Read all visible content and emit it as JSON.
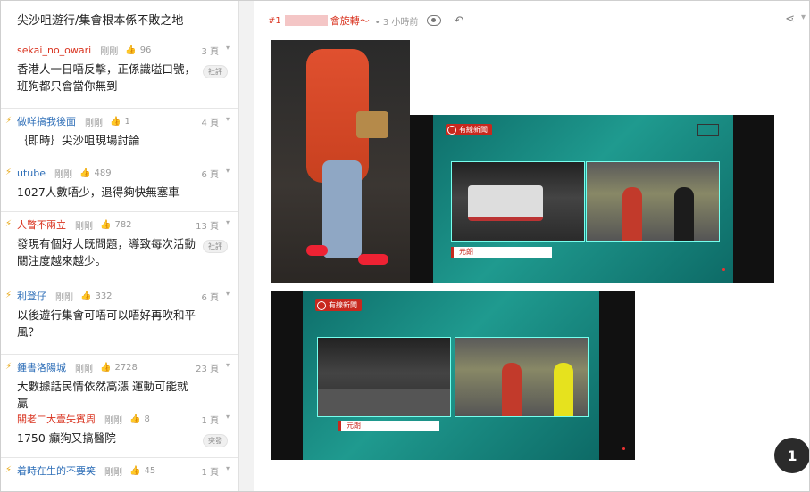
{
  "list": {
    "header": "尖沙咀遊行/集會根本係不敗之地",
    "items": [
      {
        "author": "sekai_no_owari",
        "author_color": "red",
        "bolt": false,
        "time": "剛剛",
        "likes": "96",
        "pages": "3 頁",
        "title": "香港人一日唔反擊，正係識嗌口號，班狗都只會當你無到",
        "tag": "社評",
        "size": "tall"
      },
      {
        "author": "做咩搞我後面",
        "author_color": "blue",
        "bolt": true,
        "time": "剛剛",
        "likes": "1",
        "pages": "4 頁",
        "title": "｛即時｝尖沙咀現場討論",
        "tag": "",
        "size": ""
      },
      {
        "author": "utube",
        "author_color": "blue",
        "bolt": true,
        "time": "剛剛",
        "likes": "489",
        "pages": "6 頁",
        "title": "1027人數唔少，退得夠快無塞車",
        "tag": "",
        "size": ""
      },
      {
        "author": "人瞥不兩立",
        "author_color": "red",
        "bolt": true,
        "time": "剛剛",
        "likes": "782",
        "pages": "13 頁",
        "title": "發現有個好大既問題，導致每次活動關注度越來越少。",
        "tag": "社評",
        "size": "tall"
      },
      {
        "author": "利登仔",
        "author_color": "blue",
        "bolt": true,
        "time": "剛剛",
        "likes": "332",
        "pages": "6 頁",
        "title": "以後遊行集會可唔可以唔好再吹和平風？",
        "tag": "",
        "size": "tall"
      },
      {
        "author": "鍾書洛陽城",
        "author_color": "blue",
        "bolt": true,
        "time": "剛剛",
        "likes": "2728",
        "pages": "23 頁",
        "title": "大數據話民情依然高漲 運動可能就贏",
        "tag": "",
        "size": ""
      },
      {
        "author": "關老二大壹失賓周",
        "author_color": "red",
        "bolt": false,
        "time": "剛剛",
        "likes": "8",
        "pages": "1 頁",
        "title": "1750 癲狗又搞醫院",
        "tag": "突發",
        "size": ""
      },
      {
        "author": "着時在生的不要笑",
        "author_color": "blue",
        "bolt": true,
        "time": "剛剛",
        "likes": "45",
        "pages": "1 頁",
        "title": "",
        "tag": "",
        "size": "short"
      }
    ]
  },
  "post": {
    "floor": "#1",
    "author": "會旋轉～",
    "time": "3 小時前",
    "tv_logo": "有線新聞",
    "tv_location": "元朗",
    "page_badge": "1"
  }
}
